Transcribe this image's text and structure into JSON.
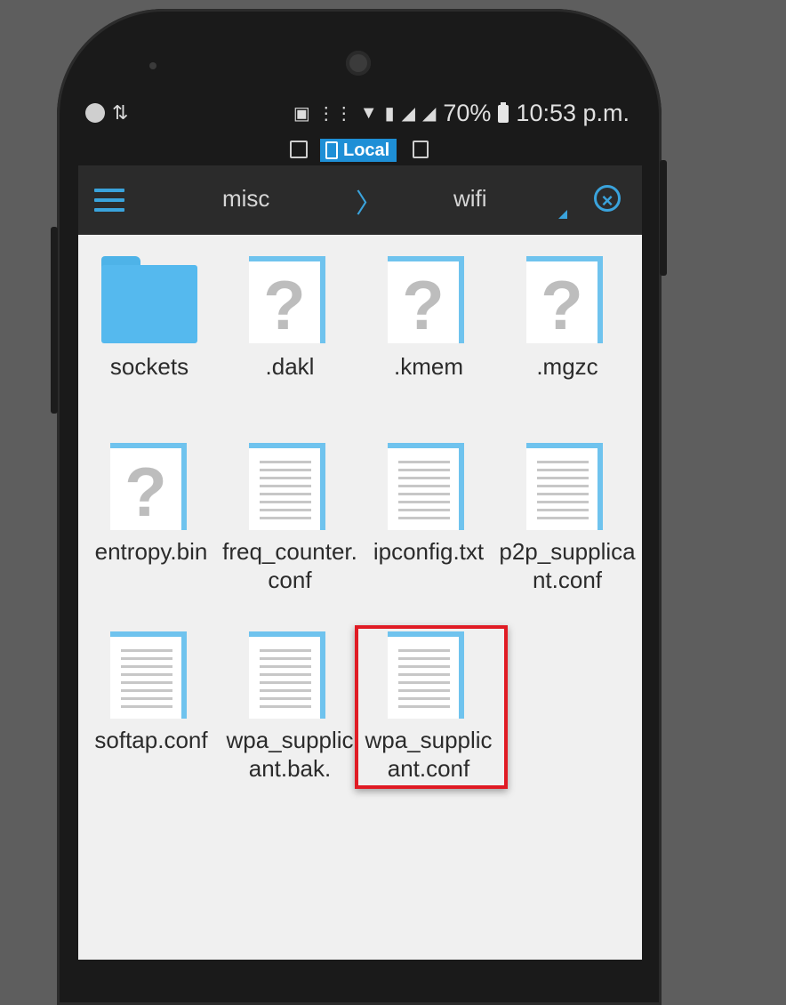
{
  "status_bar": {
    "battery_percent": "70%",
    "time": "10:53 p.m."
  },
  "location": {
    "tab_label": "Local"
  },
  "toolbar": {
    "breadcrumb": [
      "misc",
      "wifi"
    ]
  },
  "files": [
    {
      "name": "sockets",
      "type": "folder"
    },
    {
      "name": ".dakl",
      "type": "unknown"
    },
    {
      "name": ".kmem",
      "type": "unknown"
    },
    {
      "name": ".mgzc",
      "type": "unknown"
    },
    {
      "name": "entropy.bin",
      "type": "unknown"
    },
    {
      "name": "freq_counter.conf",
      "type": "doc"
    },
    {
      "name": "ipconfig.txt",
      "type": "doc"
    },
    {
      "name": "p2p_supplicant.conf",
      "type": "doc"
    },
    {
      "name": "softap.conf",
      "type": "doc"
    },
    {
      "name": "wpa_supplicant.bak.",
      "type": "doc"
    },
    {
      "name": "wpa_supplicant.conf",
      "type": "doc",
      "highlighted": true
    }
  ],
  "colors": {
    "accent": "#3aa3dc",
    "highlight": "#e01b24",
    "folder": "#55b9ee"
  }
}
